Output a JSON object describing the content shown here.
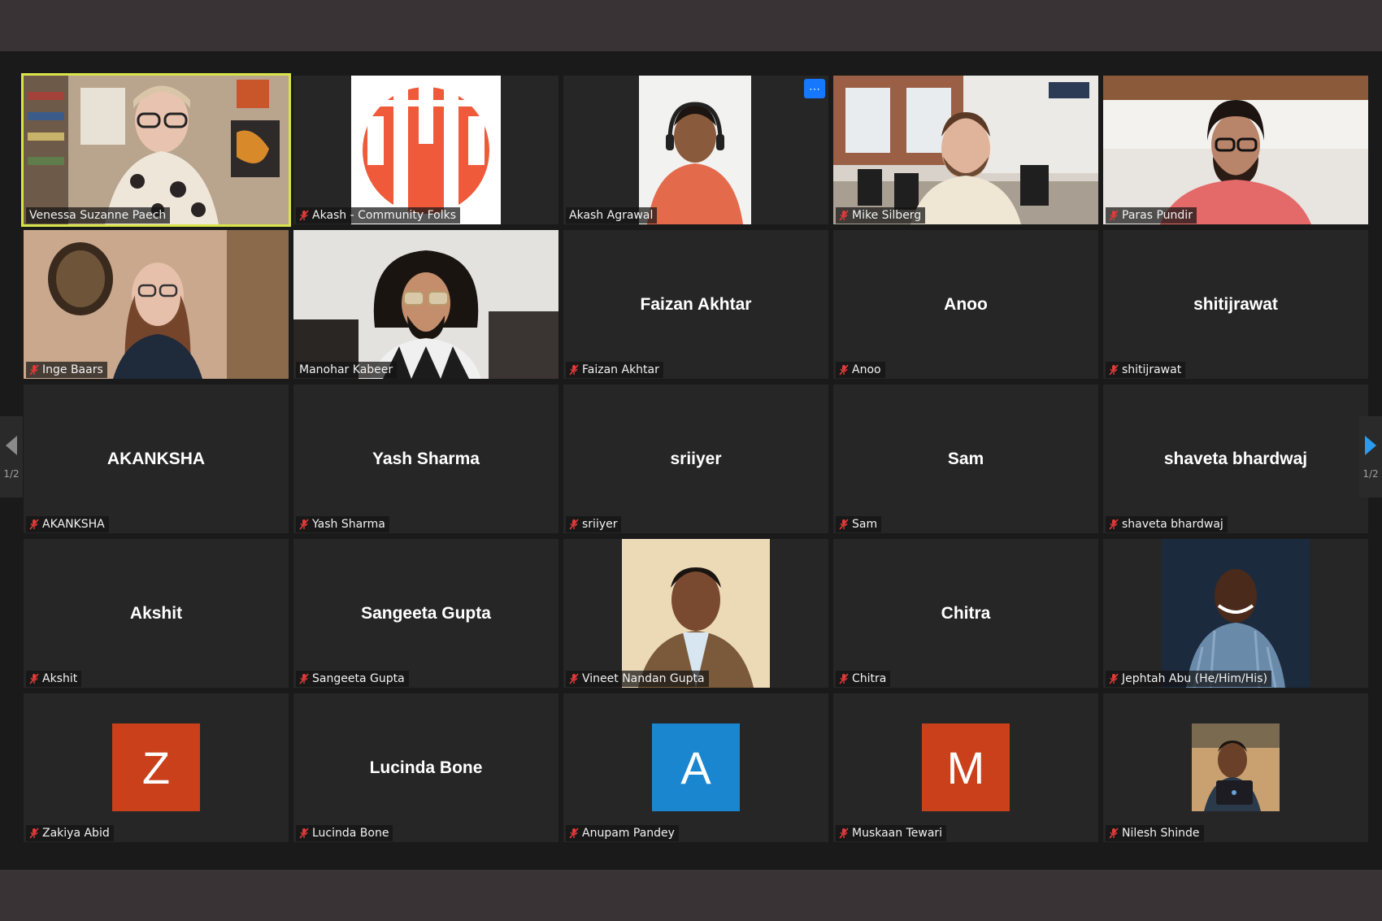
{
  "nav": {
    "page_indicator_left": "1/2",
    "page_indicator_right": "1/2"
  },
  "accent": {
    "active_speaker": "#d8e44a",
    "more_button": "#1677ff",
    "muted_icon": "#e03a3a"
  },
  "participants": [
    {
      "name": "Venessa Suzanne Paech",
      "muted": false,
      "video": true,
      "active": true
    },
    {
      "name": "Akash - Community Folks",
      "muted": true,
      "video": true
    },
    {
      "name": "Akash Agrawal",
      "muted": false,
      "video": true
    },
    {
      "name": "Mike Silberg",
      "muted": true,
      "video": true
    },
    {
      "name": "Paras Pundir",
      "muted": true,
      "video": true
    },
    {
      "name": "Inge Baars",
      "muted": true,
      "video": true
    },
    {
      "name": "Manohar Kabeer",
      "muted": false,
      "video": true
    },
    {
      "name": "Faizan Akhtar",
      "muted": true,
      "video": false
    },
    {
      "name": "Anoo",
      "muted": true,
      "video": false
    },
    {
      "name": "shitijrawat",
      "muted": true,
      "video": false
    },
    {
      "name": "AKANKSHA",
      "muted": true,
      "video": false
    },
    {
      "name": "Yash Sharma",
      "muted": true,
      "video": false
    },
    {
      "name": "sriiyer",
      "muted": true,
      "video": false
    },
    {
      "name": "Sam",
      "muted": true,
      "video": false
    },
    {
      "name": "shaveta bhardwaj",
      "muted": true,
      "video": false
    },
    {
      "name": "Akshit",
      "muted": true,
      "video": false
    },
    {
      "name": "Sangeeta Gupta",
      "muted": true,
      "video": false
    },
    {
      "name": "Vineet Nandan Gupta",
      "muted": true,
      "video": true
    },
    {
      "name": "Chitra",
      "muted": true,
      "video": false
    },
    {
      "name": "Jephtah Abu (He/Him/His)",
      "muted": true,
      "video": true
    },
    {
      "name": "Zakiya Abid",
      "muted": true,
      "avatar_letter": "Z",
      "avatar_color": "#c9401a"
    },
    {
      "name": "Lucinda Bone",
      "muted": true,
      "video": false
    },
    {
      "name": "Anupam Pandey",
      "muted": true,
      "avatar_letter": "A",
      "avatar_color": "#1a86d0"
    },
    {
      "name": "Muskaan Tewari",
      "muted": true,
      "avatar_letter": "M",
      "avatar_color": "#c9401a"
    },
    {
      "name": "Nilesh Shinde",
      "muted": true,
      "avatar_photo": true
    }
  ]
}
